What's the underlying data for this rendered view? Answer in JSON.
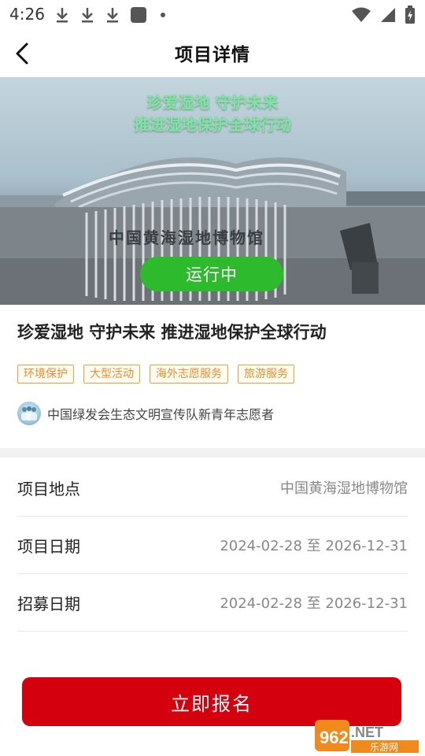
{
  "status_bar": {
    "time": "4:26"
  },
  "header": {
    "title": "项目详情"
  },
  "banner": {
    "caption_line1": "珍爱湿地 守护未来",
    "caption_line2": "推进湿地保护全球行动",
    "building_sign": "中国黄海湿地博物馆",
    "status_badge": "运行中"
  },
  "project": {
    "title": "珍爱湿地 守护未来 推进湿地保护全球行动",
    "tags": [
      "环境保护",
      "大型活动",
      "海外志愿服务",
      "旅游服务"
    ],
    "organization": "中国绿发会生态文明宣传队新青年志愿者"
  },
  "details": [
    {
      "label": "项目地点",
      "value": "中国黄海湿地博物馆"
    },
    {
      "label": "项目日期",
      "value": "2024-02-28 至 2026-12-31"
    },
    {
      "label": "招募日期",
      "value": "2024-02-28 至 2026-12-31"
    }
  ],
  "signup_label": "立即报名",
  "watermark": {
    "brand": "962.NET",
    "subtitle": "乐游网"
  },
  "colors": {
    "accent_red": "#d4000d",
    "status_green": "#2dbb2d",
    "tag_orange": "#e8a33b"
  }
}
